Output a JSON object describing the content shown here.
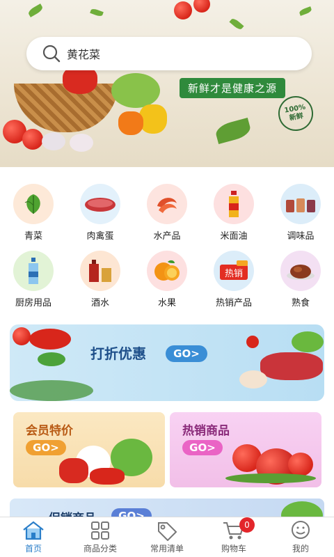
{
  "search": {
    "value": "黄花菜",
    "placeholder": "黄花菜"
  },
  "hero": {
    "slogan": "新鲜才是健康之源",
    "seal_top": "100%",
    "seal_bottom": "新鲜"
  },
  "categories": [
    {
      "label": "青菜",
      "icon": "vegetable-leaf-icon",
      "bg": "#fde9d8"
    },
    {
      "label": "肉禽蛋",
      "icon": "meat-icon",
      "bg": "#e3f1fb"
    },
    {
      "label": "水产品",
      "icon": "shrimp-icon",
      "bg": "#fde4df"
    },
    {
      "label": "米面油",
      "icon": "oil-bottle-icon",
      "bg": "#fde0e0"
    },
    {
      "label": "调味品",
      "icon": "seasoning-icon",
      "bg": "#dcedf9"
    },
    {
      "label": "厨房用品",
      "icon": "kitchen-bottle-icon",
      "bg": "#e2f3d6"
    },
    {
      "label": "酒水",
      "icon": "liquor-icon",
      "bg": "#fde6d3"
    },
    {
      "label": "水果",
      "icon": "orange-icon",
      "bg": "#fde0e0"
    },
    {
      "label": "热销产品",
      "icon": "hot-sale-icon",
      "bg": "#dcedf9"
    },
    {
      "label": "熟食",
      "icon": "cooked-meat-icon",
      "bg": "#f3e0f3"
    }
  ],
  "banner": {
    "title": "打折优惠",
    "go": "GO>"
  },
  "cards": [
    {
      "title": "会员特价",
      "go": "GO>"
    },
    {
      "title": "热销商品",
      "go": "GO>"
    }
  ],
  "promo": {
    "title": "促销商品",
    "go": "GO>"
  },
  "tabs": [
    {
      "label": "首页",
      "icon": "home-icon",
      "active": true
    },
    {
      "label": "商品分类",
      "icon": "grid-icon",
      "active": false
    },
    {
      "label": "常用清单",
      "icon": "tag-icon",
      "active": false
    },
    {
      "label": "购物车",
      "icon": "cart-icon",
      "active": false,
      "badge": "0"
    },
    {
      "label": "我的",
      "icon": "user-icon",
      "active": false
    }
  ],
  "colors": {
    "accent": "#2a7ec9",
    "badge": "#e3262b",
    "slogan_bg": "#2f8a3c"
  }
}
